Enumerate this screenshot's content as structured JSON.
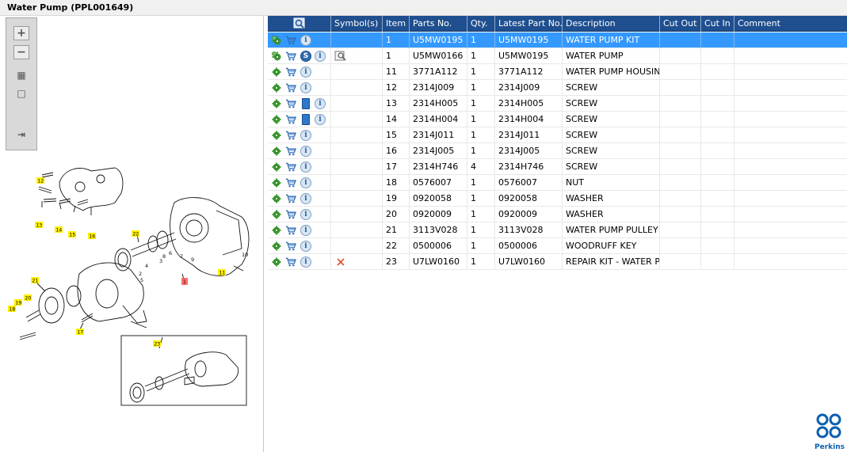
{
  "window": {
    "title": "Water Pump (PPL001649)"
  },
  "toolbar": [
    {
      "name": "zoom-in-button",
      "glyph": "+"
    },
    {
      "name": "zoom-out-button",
      "glyph": "−"
    },
    {
      "name": "fit-all-button",
      "glyph": "▦"
    },
    {
      "name": "actual-size-button",
      "glyph": "□"
    },
    {
      "name": "export-button",
      "glyph": "⇥"
    }
  ],
  "columns": {
    "view": "",
    "symbols": "Symbol(s)",
    "item": "Item",
    "parts_no": "Parts No.",
    "qty": "Qty.",
    "latest": "Latest Part No.",
    "description": "Description",
    "cut_out": "Cut Out",
    "cut_in": "Cut In",
    "comment": "Comment"
  },
  "rows": [
    {
      "item": "1",
      "parts_no": "U5MW0195",
      "qty": "1",
      "latest": "U5MW0195",
      "description": "WATER PUMP KIT",
      "selected": true,
      "gear": "multi",
      "extra": "",
      "symbol": ""
    },
    {
      "item": "1",
      "parts_no": "U5MW0166",
      "qty": "1",
      "latest": "U5MW0195",
      "description": "WATER PUMP",
      "selected": false,
      "gear": "multi",
      "extra": "s",
      "symbol": "view"
    },
    {
      "item": "11",
      "parts_no": "3771A112",
      "qty": "1",
      "latest": "3771A112",
      "description": "WATER PUMP HOUSING",
      "selected": false,
      "gear": "single",
      "extra": "",
      "symbol": ""
    },
    {
      "item": "12",
      "parts_no": "2314J009",
      "qty": "1",
      "latest": "2314J009",
      "description": "SCREW",
      "selected": false,
      "gear": "single",
      "extra": "",
      "symbol": ""
    },
    {
      "item": "13",
      "parts_no": "2314H005",
      "qty": "1",
      "latest": "2314H005",
      "description": "SCREW",
      "selected": false,
      "gear": "single",
      "extra": "book",
      "symbol": ""
    },
    {
      "item": "14",
      "parts_no": "2314H004",
      "qty": "1",
      "latest": "2314H004",
      "description": "SCREW",
      "selected": false,
      "gear": "single",
      "extra": "book",
      "symbol": ""
    },
    {
      "item": "15",
      "parts_no": "2314J011",
      "qty": "1",
      "latest": "2314J011",
      "description": "SCREW",
      "selected": false,
      "gear": "single",
      "extra": "",
      "symbol": ""
    },
    {
      "item": "16",
      "parts_no": "2314J005",
      "qty": "1",
      "latest": "2314J005",
      "description": "SCREW",
      "selected": false,
      "gear": "single",
      "extra": "",
      "symbol": ""
    },
    {
      "item": "17",
      "parts_no": "2314H746",
      "qty": "4",
      "latest": "2314H746",
      "description": "SCREW",
      "selected": false,
      "gear": "single",
      "extra": "",
      "symbol": ""
    },
    {
      "item": "18",
      "parts_no": "0576007",
      "qty": "1",
      "latest": "0576007",
      "description": "NUT",
      "selected": false,
      "gear": "single",
      "extra": "",
      "symbol": ""
    },
    {
      "item": "19",
      "parts_no": "0920058",
      "qty": "1",
      "latest": "0920058",
      "description": "WASHER",
      "selected": false,
      "gear": "single",
      "extra": "",
      "symbol": ""
    },
    {
      "item": "20",
      "parts_no": "0920009",
      "qty": "1",
      "latest": "0920009",
      "description": "WASHER",
      "selected": false,
      "gear": "single",
      "extra": "",
      "symbol": ""
    },
    {
      "item": "21",
      "parts_no": "3113V028",
      "qty": "1",
      "latest": "3113V028",
      "description": "WATER PUMP PULLEY",
      "selected": false,
      "gear": "single",
      "extra": "",
      "symbol": ""
    },
    {
      "item": "22",
      "parts_no": "0500006",
      "qty": "1",
      "latest": "0500006",
      "description": "WOODRUFF KEY",
      "selected": false,
      "gear": "single",
      "extra": "",
      "symbol": ""
    },
    {
      "item": "23",
      "parts_no": "U7LW0160",
      "qty": "1",
      "latest": "U7LW0160",
      "description": "REPAIR KIT - WATER PUMP",
      "selected": false,
      "gear": "single",
      "extra": "",
      "symbol": "remove"
    }
  ],
  "drawing": {
    "callouts": [
      "12",
      "13",
      "14",
      "15",
      "16",
      "22",
      "21",
      "19",
      "20",
      "18",
      "17",
      "23",
      "11",
      "1",
      "10"
    ],
    "labels": [
      "2",
      "3",
      "4",
      "5",
      "6",
      "7",
      "8",
      "9"
    ]
  },
  "brand": {
    "name": "Perkins",
    "color": "#0b5fb0"
  },
  "colors": {
    "header": "#1f4f8f",
    "selection": "#3399ff",
    "gear": "#3b9c2e",
    "cart": "#2f6cb5"
  }
}
